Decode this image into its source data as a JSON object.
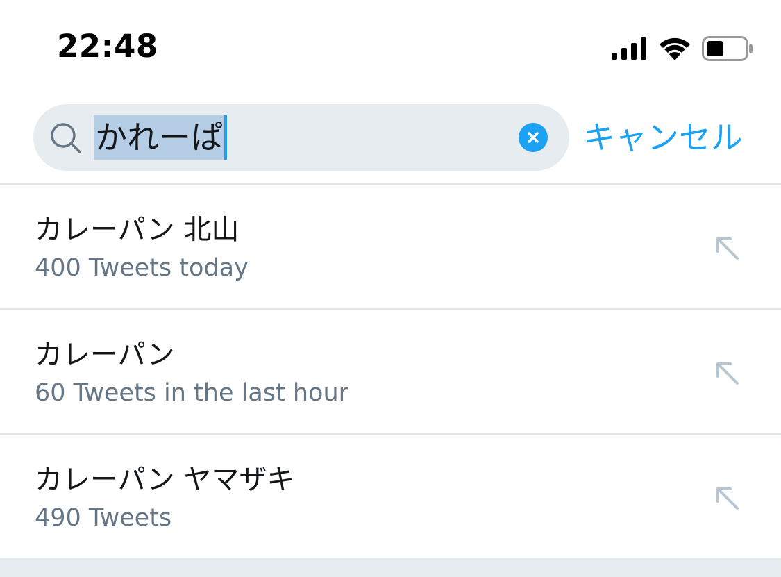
{
  "status_bar": {
    "time": "22:48",
    "icons": [
      "signal-icon",
      "wifi-icon",
      "battery-icon"
    ]
  },
  "search": {
    "query": "かれーぱ",
    "cancel_label": "キャンセル",
    "icons": [
      "search-icon",
      "clear-icon"
    ]
  },
  "results": [
    {
      "title": "カレーパン 北山",
      "subtitle": "400 Tweets today",
      "icon": "fill-query-arrow-icon"
    },
    {
      "title": "カレーパン",
      "subtitle": "60 Tweets in the last hour",
      "icon": "fill-query-arrow-icon"
    },
    {
      "title": "カレーパン ヤマザキ",
      "subtitle": "490 Tweets",
      "icon": "fill-query-arrow-icon"
    }
  ],
  "colors": {
    "accent": "#1da1f2",
    "search_background": "#e6ecf0",
    "selection": "#b6cde6",
    "primary_text": "#14171a",
    "secondary_text": "#657786",
    "divider": "#e1e8ed"
  }
}
